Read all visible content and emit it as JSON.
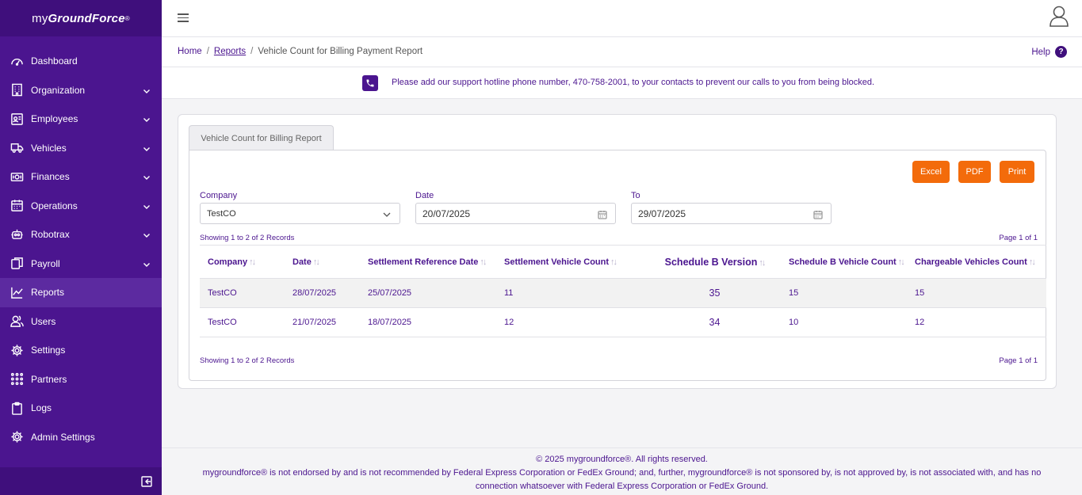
{
  "brand": {
    "prefix": "my",
    "name": "GroundForce",
    "mark": "®"
  },
  "sidebar": {
    "items": [
      {
        "label": "Dashboard",
        "icon": "dashboard-icon",
        "chevron": false
      },
      {
        "label": "Organization",
        "icon": "building-icon",
        "chevron": true
      },
      {
        "label": "Employees",
        "icon": "id-badge-icon",
        "chevron": true
      },
      {
        "label": "Vehicles",
        "icon": "truck-icon",
        "chevron": true
      },
      {
        "label": "Finances",
        "icon": "money-icon",
        "chevron": true
      },
      {
        "label": "Operations",
        "icon": "calendar-icon",
        "chevron": true
      },
      {
        "label": "Robotrax",
        "icon": "robot-icon",
        "chevron": true
      },
      {
        "label": "Payroll",
        "icon": "copy-icon",
        "chevron": true
      },
      {
        "label": "Reports",
        "icon": "chart-line-icon",
        "chevron": false,
        "active": true
      },
      {
        "label": "Users",
        "icon": "users-icon",
        "chevron": false
      },
      {
        "label": "Settings",
        "icon": "gear-icon",
        "chevron": false
      },
      {
        "label": "Partners",
        "icon": "grid-icon",
        "chevron": false
      },
      {
        "label": "Logs",
        "icon": "clipboard-icon",
        "chevron": false
      },
      {
        "label": "Admin Settings",
        "icon": "admin-gear-icon",
        "chevron": false
      }
    ]
  },
  "breadcrumb": {
    "home": "Home",
    "sep": "/",
    "reports": "Reports",
    "current": "Vehicle Count for Billing Payment Report"
  },
  "help": {
    "label": "Help",
    "icon_glyph": "?"
  },
  "notice": {
    "text": "Please add our support hotline phone number, 470-758-2001, to your contacts to prevent our calls to you from being blocked."
  },
  "report": {
    "tab": "Vehicle Count for Billing Report",
    "buttons": {
      "excel": "Excel",
      "pdf": "PDF",
      "print": "Print"
    },
    "filters": {
      "company": {
        "label": "Company",
        "value": "TestCO"
      },
      "date": {
        "label": "Date",
        "value": "20/07/2025"
      },
      "to": {
        "label": "To",
        "value": "29/07/2025"
      }
    },
    "showing_top": "Showing 1 to 2 of 2 Records",
    "page_top": "Page 1 of 1",
    "showing_bottom": "Showing 1 to 2 of 2 Records",
    "page_bottom": "Page 1 of 1",
    "columns": [
      "Company",
      "Date",
      "Settlement Reference Date",
      "Settlement Vehicle Count",
      "Schedule B Version",
      "Schedule B Vehicle Count",
      "Chargeable Vehicles Count"
    ],
    "sort_glyph": "↑↓",
    "rows": [
      [
        "TestCO",
        "28/07/2025",
        "25/07/2025",
        "11",
        "35",
        "15",
        "15"
      ],
      [
        "TestCO",
        "21/07/2025",
        "18/07/2025",
        "12",
        "34",
        "10",
        "12"
      ]
    ]
  },
  "footer": {
    "line1": "© 2025 mygroundforce®. All rights reserved.",
    "line2": "mygroundforce® is not endorsed by and is not recommended by Federal Express Corporation or FedEx Ground; and, further, mygroundforce® is not sponsored by, is not approved by, is not associated with, and has no",
    "line3": "connection whatsoever with Federal Express Corporation or FedEx Ground."
  },
  "colors": {
    "sidebar": "#4b158f",
    "accent": "#f36b0b",
    "text": "#4b158f"
  }
}
